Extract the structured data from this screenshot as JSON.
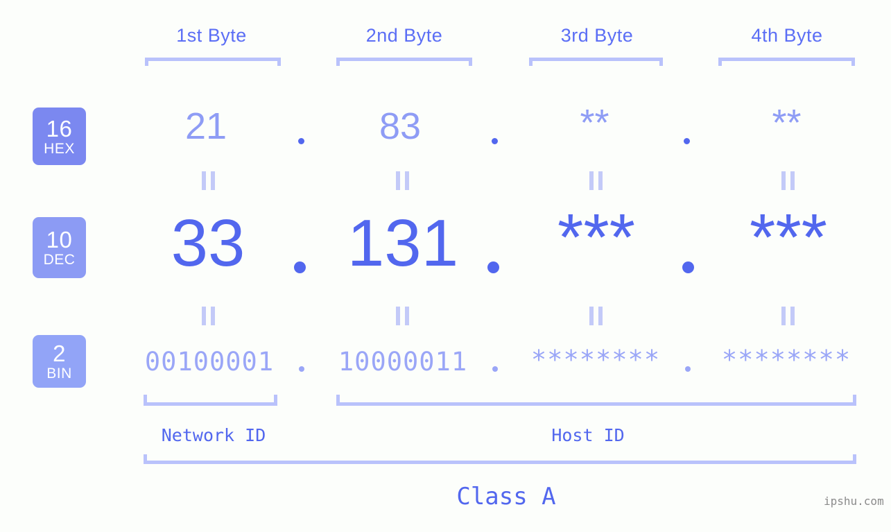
{
  "header": {
    "byte_labels": [
      {
        "label": "1st Byte"
      },
      {
        "label": "2nd Byte"
      },
      {
        "label": "3rd Byte"
      },
      {
        "label": "4th Byte"
      }
    ]
  },
  "rows": [
    {
      "badge_number": "16",
      "badge_name": "HEX",
      "badge_color": "#7b88f0",
      "values": [
        "21",
        "83",
        "**",
        "**"
      ],
      "separator": "."
    },
    {
      "badge_number": "10",
      "badge_name": "DEC",
      "badge_color": "#8c9bf4",
      "values": [
        "33",
        "131",
        "***",
        "***"
      ],
      "separator": "."
    },
    {
      "badge_number": "2",
      "badge_name": "BIN",
      "badge_color": "#92a4f7",
      "values": [
        "00100001",
        "10000011",
        "********",
        "********"
      ],
      "separator": "."
    }
  ],
  "equals_marks": {
    "glyph": "||",
    "count_per_gap": 4
  },
  "footer": {
    "network_id_label": "Network ID",
    "host_id_label": "Host ID",
    "class_label": "Class A",
    "watermark": "ipshu.com"
  },
  "colors": {
    "background": "#fcfefb",
    "bracket": "#b9c2fb",
    "accent_strong": "#5267ee",
    "accent_mid": "#8e9cf5",
    "accent_light": "#9aa6f7",
    "equals_mark": "#c3caf8"
  }
}
